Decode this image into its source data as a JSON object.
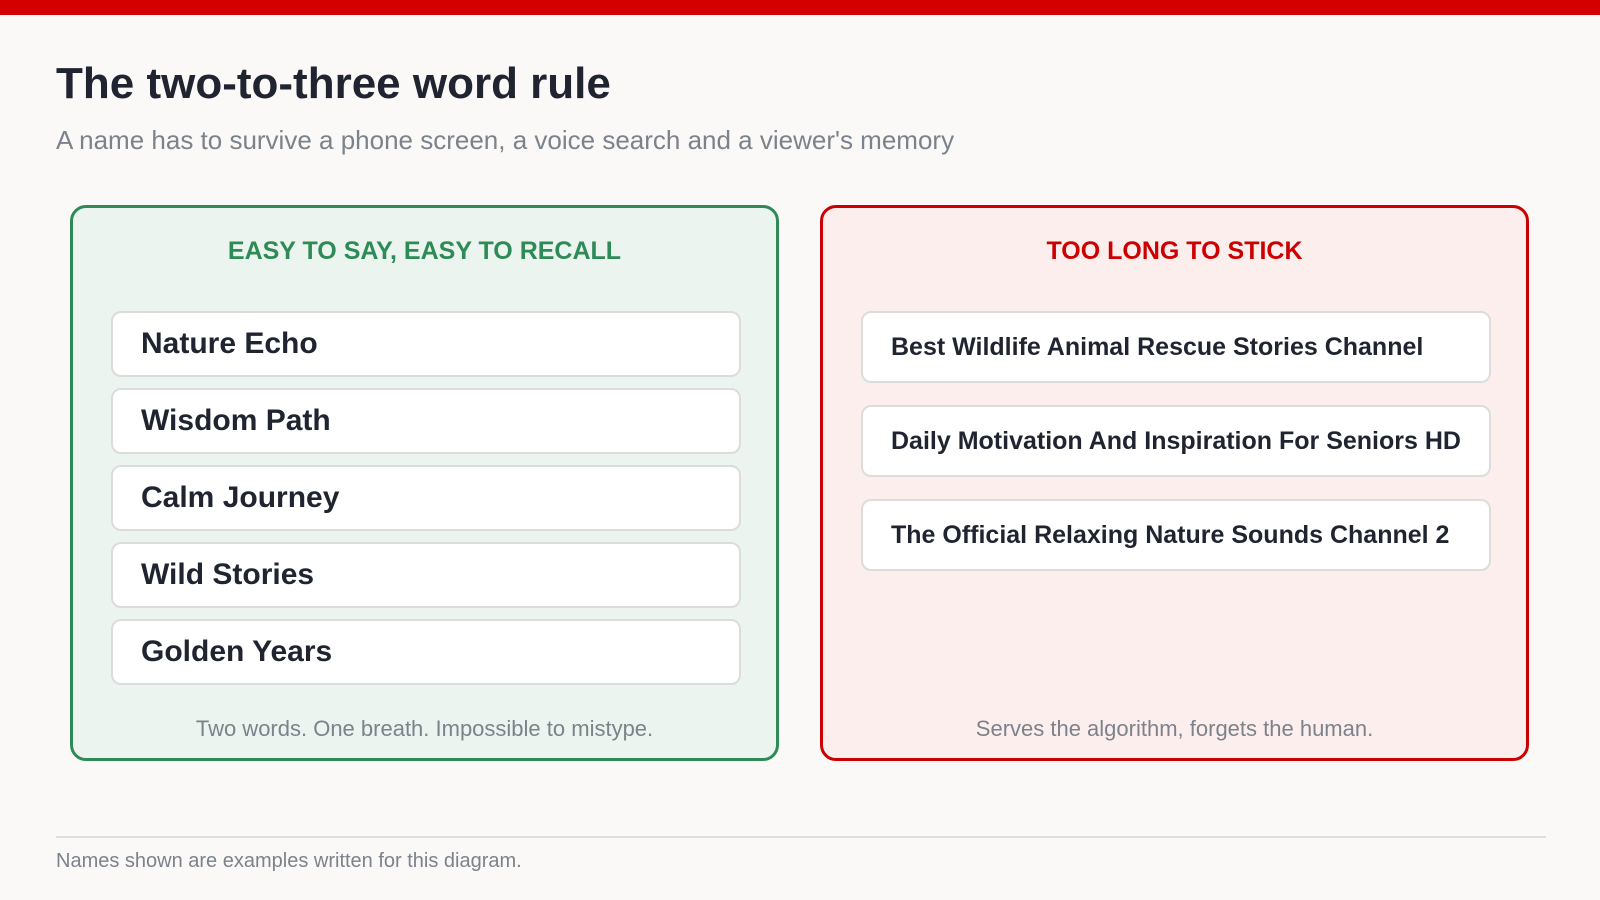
{
  "header": {
    "title": "The two-to-three word rule",
    "subtitle": "A name has to survive a phone screen, a voice search and a viewer's memory"
  },
  "panels": {
    "good": {
      "heading": "EASY TO SAY, EASY TO RECALL",
      "names": [
        "Nature Echo",
        "Wisdom Path",
        "Calm Journey",
        "Wild Stories",
        "Golden Years"
      ],
      "caption": "Two words. One breath. Impossible to mistype."
    },
    "bad": {
      "heading": "TOO LONG TO STICK",
      "names": [
        "Best Wildlife Animal Rescue Stories Channel",
        "Daily Motivation And Inspiration For Seniors HD",
        "The Official Relaxing Nature Sounds Channel 2"
      ],
      "caption": "Serves the algorithm, forgets the human."
    }
  },
  "footer": {
    "note": "Names shown are examples written for this diagram."
  },
  "colors": {
    "accent_red": "#d40000",
    "good_green": "#2e8b57",
    "bad_red": "#cc0000"
  }
}
